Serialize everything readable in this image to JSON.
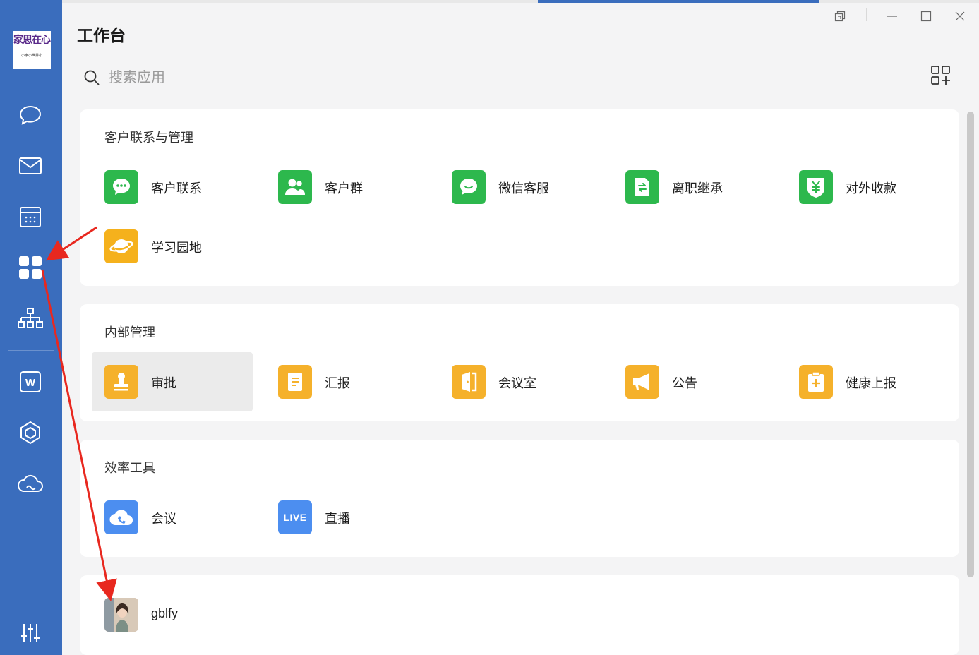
{
  "window": {
    "title": "工作台",
    "controls": [
      "restore-window-icon",
      "minimize-icon",
      "maximize-icon",
      "close-icon"
    ]
  },
  "logo": {
    "text": "家思在心",
    "sub": "小家小世界小"
  },
  "search": {
    "placeholder": "搜索应用",
    "value": ""
  },
  "sidebar": {
    "items": [
      {
        "name": "messages",
        "icon": "chat-bubble-icon"
      },
      {
        "name": "mail",
        "icon": "mail-icon"
      },
      {
        "name": "calendar",
        "icon": "calendar-icon"
      },
      {
        "name": "workbench",
        "icon": "grid-icon",
        "active": true
      },
      {
        "name": "contacts",
        "icon": "org-chart-icon"
      },
      {
        "name": "documents",
        "icon": "word-doc-icon"
      },
      {
        "name": "workspace",
        "icon": "cube-icon"
      },
      {
        "name": "drive",
        "icon": "cloud-icon"
      },
      {
        "name": "settings",
        "icon": "sliders-icon"
      }
    ]
  },
  "sections": [
    {
      "title": "客户联系与管理",
      "apps": [
        {
          "label": "客户联系",
          "icon": "chat-dots-icon",
          "color": "#2db84d"
        },
        {
          "label": "客户群",
          "icon": "group-icon",
          "color": "#2db84d"
        },
        {
          "label": "微信客服",
          "icon": "smile-chat-icon",
          "color": "#2db84d"
        },
        {
          "label": "离职继承",
          "icon": "transfer-doc-icon",
          "color": "#2db84d"
        },
        {
          "label": "对外收款",
          "icon": "yuan-shield-icon",
          "color": "#2db84d"
        },
        {
          "label": "学习园地",
          "icon": "planet-icon",
          "color": "#f5b11c"
        }
      ]
    },
    {
      "title": "内部管理",
      "apps": [
        {
          "label": "审批",
          "icon": "stamp-icon",
          "color": "#f5b12b",
          "selected": true
        },
        {
          "label": "汇报",
          "icon": "report-doc-icon",
          "color": "#f5b12b"
        },
        {
          "label": "会议室",
          "icon": "door-icon",
          "color": "#f5b12b"
        },
        {
          "label": "公告",
          "icon": "megaphone-icon",
          "color": "#f5b12b"
        },
        {
          "label": "健康上报",
          "icon": "health-clipboard-icon",
          "color": "#f5b12b"
        }
      ]
    },
    {
      "title": "效率工具",
      "apps": [
        {
          "label": "会议",
          "icon": "cloud-phone-icon",
          "color": "#4c8ef0"
        },
        {
          "label": "直播",
          "icon": "live-icon",
          "color": "#4c8ef0",
          "badge": "LIVE"
        }
      ]
    },
    {
      "title": "",
      "apps": [
        {
          "label": "gblfy",
          "icon": "user-avatar-icon",
          "color": "#c9a98e"
        }
      ]
    }
  ],
  "colors": {
    "sidebar": "#3a6dbd",
    "annotation_arrow": "#e8281f"
  }
}
